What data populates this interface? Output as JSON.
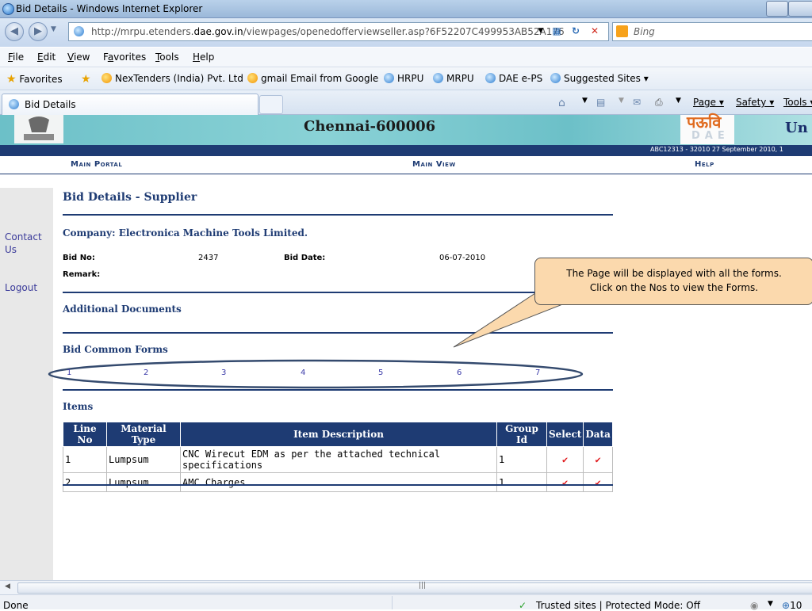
{
  "window": {
    "title": "Bid Details - Windows Internet Explorer"
  },
  "address_bar": {
    "url_prefix": "http://mrpu.etenders.",
    "url_domain": "dae.gov.in",
    "url_suffix": "/viewpages/openedofferviewseller.asp?6F52207C499953AB52A176",
    "search_placeholder": "Bing"
  },
  "menubar": {
    "items": [
      {
        "label": "File",
        "ul": "F",
        "rest": "ile"
      },
      {
        "label": "Edit",
        "ul": "E",
        "rest": "dit"
      },
      {
        "label": "View",
        "ul": "V",
        "rest": "iew"
      },
      {
        "label": "Favorites",
        "pre": "F",
        "ul": "a",
        "rest": "vorites"
      },
      {
        "label": "Tools",
        "ul": "T",
        "rest": "ools"
      },
      {
        "label": "Help",
        "ul": "H",
        "rest": "elp"
      }
    ]
  },
  "favorites_bar": {
    "favorites_label": "Favorites",
    "links": [
      "NexTenders (India) Pvt. Ltd",
      "gmail Email from Google",
      "HRPU",
      "MRPU",
      "DAE e-PS",
      "Suggested Sites ▾"
    ]
  },
  "tab": {
    "label": "Bid Details"
  },
  "command_bar": {
    "page": "Page ▾",
    "safety": "Safety ▾",
    "tools": "Tools ▾"
  },
  "header": {
    "city": "Chennai-600006",
    "dae_logo_text": "पऊवि",
    "dae_logo_sub": "DAE",
    "right_fragment": "Un",
    "info_line": "ABC12313 - 32010    27 September 2010,  1",
    "nav": {
      "main_portal": "Main Portal",
      "main_view": "Main View",
      "help": "Help"
    }
  },
  "sidebar": {
    "contact": "Contact Us",
    "logout": "Logout"
  },
  "page": {
    "title": "Bid Details - Supplier",
    "company": "Company: Electronica Machine Tools Limited.",
    "bid_no_label": "Bid No:",
    "bid_no": "2437",
    "bid_date_label": "Bid Date:",
    "bid_date": "06-07-2010",
    "remark_label": "Remark:",
    "additional_documents": "Additional Documents",
    "bid_common_forms": "Bid Common Forms",
    "form_numbers": [
      "1",
      "2",
      "3",
      "4",
      "5",
      "6",
      "7"
    ],
    "items_heading": "Items",
    "items_table": {
      "headers": [
        "Line No",
        "Material Type",
        "Item Description",
        "Group Id",
        "Select",
        "Data"
      ],
      "rows": [
        [
          "1",
          "Lumpsum",
          "CNC Wirecut EDM as per the attached technical specifications",
          "1",
          "✔",
          "✔"
        ],
        [
          "2",
          "Lumpsum",
          "AMC Charges",
          "1",
          "✔",
          "✔"
        ]
      ]
    }
  },
  "callout": {
    "line1": "The Page will be displayed with all  the forms.",
    "line2": "Click on the Nos to view the Forms."
  },
  "statusbar": {
    "done": "Done",
    "zone": "Trusted sites | Protected Mode: Off",
    "zoom": "10"
  },
  "colors": {
    "navy": "#1e3b73",
    "callout_fill": "#fbd9ad",
    "check_red": "#e0181b"
  }
}
